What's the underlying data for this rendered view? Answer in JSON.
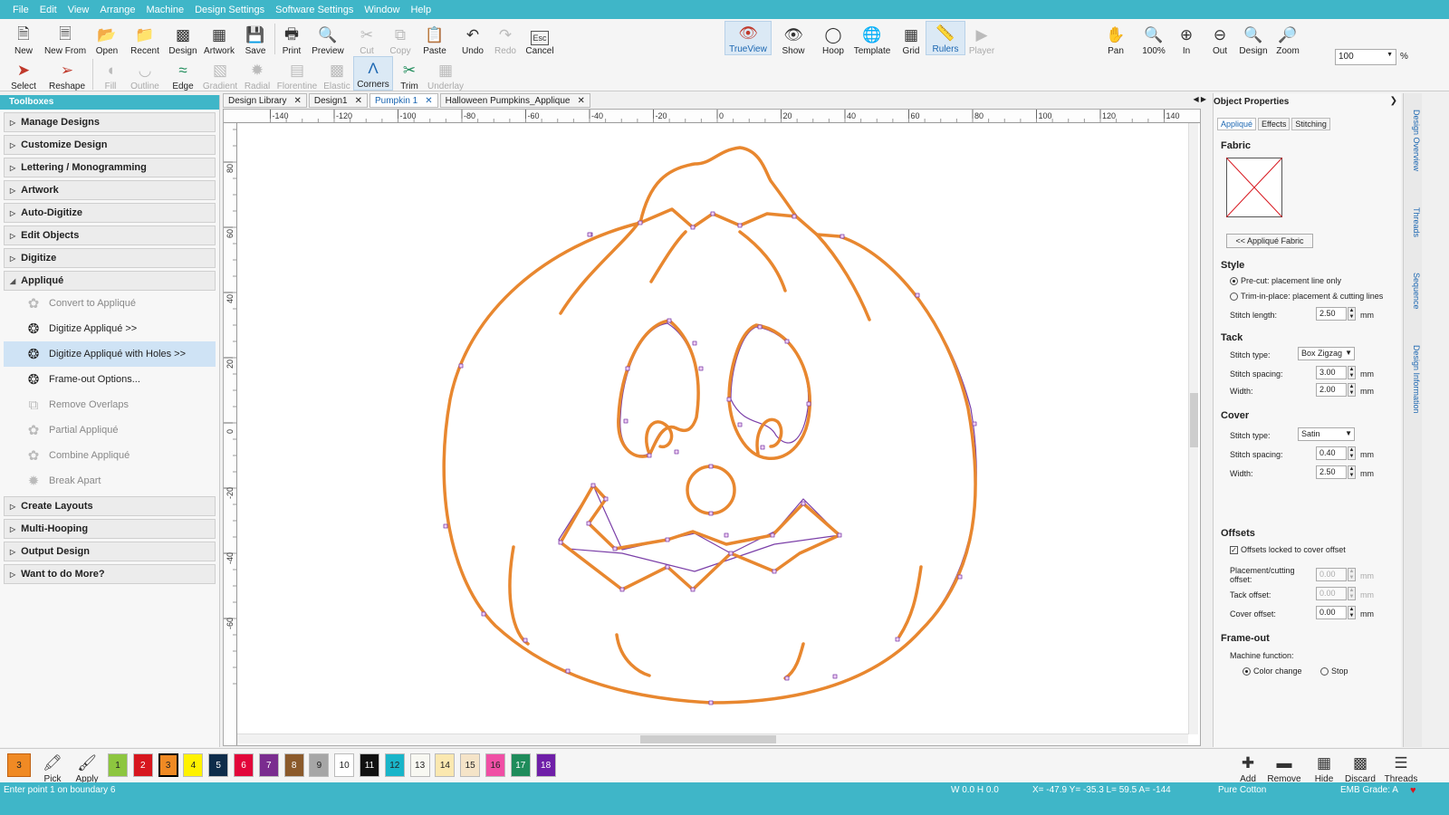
{
  "menu": [
    "File",
    "Edit",
    "View",
    "Arrange",
    "Machine",
    "Design Settings",
    "Software Settings",
    "Window",
    "Help"
  ],
  "toolbar_top": {
    "new": "New",
    "new_from": "New From",
    "open": "Open",
    "recent": "Recent",
    "design": "Design",
    "artwork": "Artwork",
    "save": "Save",
    "print": "Print",
    "preview": "Preview",
    "cut": "Cut",
    "copy": "Copy",
    "paste": "Paste",
    "undo": "Undo",
    "redo": "Redo",
    "cancel": "Cancel",
    "esc": "Esc",
    "trueview": "TrueView",
    "show": "Show",
    "hoop": "Hoop",
    "template": "Template",
    "grid": "Grid",
    "rulers": "Rulers",
    "player": "Player",
    "pan": "Pan",
    "zoom100": "100%",
    "zoom_in": "In",
    "zoom_out": "Out",
    "zoom_design": "Design",
    "zoom": "Zoom",
    "zoom_value": "100",
    "zoom_unit": "%"
  },
  "toolbar_bottom": {
    "select": "Select",
    "reshape": "Reshape",
    "fill": "Fill",
    "outline": "Outline",
    "edge": "Edge",
    "gradient": "Gradient",
    "radial": "Radial",
    "florentine": "Florentine",
    "elastic": "Elastic",
    "corners": "Corners",
    "trim": "Trim",
    "underlay": "Underlay"
  },
  "toolboxes": {
    "title": "Toolboxes",
    "cats_top": [
      "Manage Designs",
      "Customize Design",
      "Lettering / Monogramming",
      "Artwork",
      "Auto-Digitize",
      "Edit Objects",
      "Digitize"
    ],
    "applique": "Appliqué",
    "applique_items": [
      "Convert to Appliqué",
      "Digitize Appliqué >>",
      "Digitize Appliqué with Holes >>",
      "Frame-out Options...",
      "Remove Overlaps",
      "Partial Appliqué",
      "Combine Appliqué",
      "Break Apart"
    ],
    "cats_bottom": [
      "Create Layouts",
      "Multi-Hooping",
      "Output Design",
      "Want to do More?"
    ]
  },
  "tabs": [
    "Design Library",
    "Design1",
    "Pumpkin 1",
    "Halloween Pumpkins_Applique"
  ],
  "ruler_h": [
    "-140",
    "-120",
    "-100",
    "-80",
    "-60",
    "-40",
    "-20",
    "0",
    "20",
    "40",
    "60",
    "80",
    "100",
    "120",
    "140"
  ],
  "ruler_v": [
    "80",
    "60",
    "40",
    "20",
    "0",
    "-20",
    "-40",
    "-60"
  ],
  "props": {
    "title": "Object Properties",
    "tabs": [
      "Appliqué",
      "Effects",
      "Stitching"
    ],
    "fabric": "Fabric",
    "fabric_btn": "<< Appliqué Fabric",
    "style": "Style",
    "style_opt1": "Pre-cut: placement line only",
    "style_opt2": "Trim-in-place: placement & cutting lines",
    "stitch_length": "Stitch length:",
    "stitch_length_val": "2.50",
    "tack": "Tack",
    "stitch_type": "Stitch type:",
    "tack_type": "Box Zigzag",
    "stitch_spacing": "Stitch spacing:",
    "tack_spacing": "3.00",
    "width": "Width:",
    "tack_width": "2.00",
    "cover": "Cover",
    "cover_type": "Satin",
    "cover_spacing": "0.40",
    "cover_width": "2.50",
    "offsets": "Offsets",
    "offsets_locked": "Offsets locked to cover offset",
    "placement_offset": "Placement/cutting offset:",
    "placement_val": "0.00",
    "tack_offset": "Tack offset:",
    "tack_offset_val": "0.00",
    "cover_offset": "Cover offset:",
    "cover_offset_val": "0.00",
    "frameout": "Frame-out",
    "machine_function": "Machine function:",
    "color_change": "Color change",
    "stop": "Stop",
    "mm": "mm"
  },
  "side_tabs": [
    "Design Overview",
    "Threads",
    "Sequence",
    "Design Information"
  ],
  "bottom": {
    "current": "3",
    "pick": "Pick",
    "apply": "Apply",
    "swatches": [
      {
        "n": "1",
        "c": "#8dc63f"
      },
      {
        "n": "2",
        "c": "#d7161e"
      },
      {
        "n": "3",
        "c": "#f08a24"
      },
      {
        "n": "4",
        "c": "#fff200"
      },
      {
        "n": "5",
        "c": "#0e2c4a"
      },
      {
        "n": "6",
        "c": "#e2063a"
      },
      {
        "n": "7",
        "c": "#7a2c8f"
      },
      {
        "n": "8",
        "c": "#8b5a2b"
      },
      {
        "n": "9",
        "c": "#a6a6a6"
      },
      {
        "n": "10",
        "c": "#ffffff"
      },
      {
        "n": "11",
        "c": "#111111"
      },
      {
        "n": "12",
        "c": "#19b5c9"
      },
      {
        "n": "13",
        "c": "#f8f8f2"
      },
      {
        "n": "14",
        "c": "#fbe8b0"
      },
      {
        "n": "15",
        "c": "#f5e4c8"
      },
      {
        "n": "16",
        "c": "#f04fa5"
      },
      {
        "n": "17",
        "c": "#1f8c5b"
      },
      {
        "n": "18",
        "c": "#6f1fa8"
      }
    ],
    "add": "Add",
    "remove": "Remove",
    "hide": "Hide",
    "discard": "Discard",
    "threads": "Threads"
  },
  "status": {
    "prompt": "Enter point 1 on boundary 6",
    "wh": "W  0.0 H  0.0",
    "coords": "X= -47.9 Y= -35.3 L= 59.5 A= -144",
    "thread": "Pure Cotton",
    "grade": "EMB Grade: A"
  },
  "colors": {
    "accent": "#3fb6c8",
    "stitch": "#e8872f",
    "outline": "#7b3fa8"
  }
}
